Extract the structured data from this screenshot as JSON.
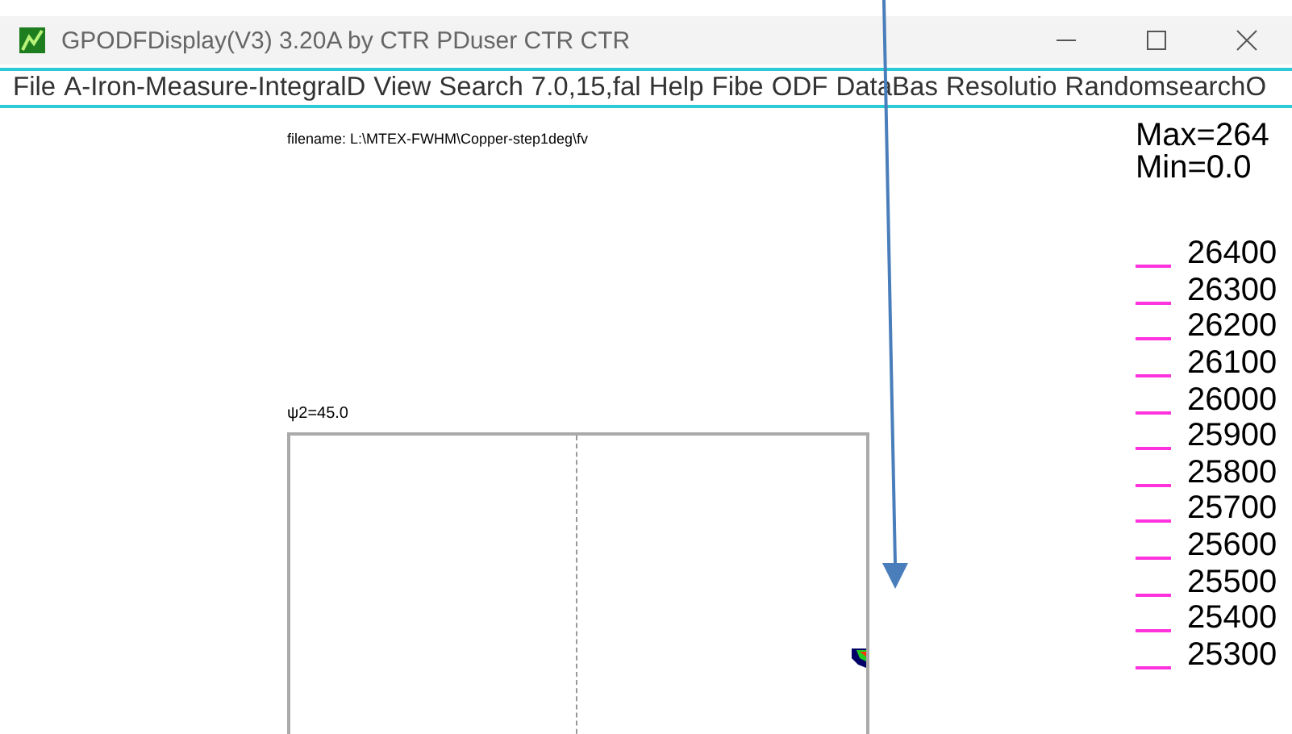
{
  "window": {
    "title": "GPODFDisplay(V3) 3.20A by CTR PDuser CTR CTR"
  },
  "menu": [
    "File",
    "A-Iron-Measure-IntegralD",
    "View",
    "Search",
    "7.0,15,fal",
    "Help",
    "Fibe",
    "ODF",
    "DataBas",
    "Resolutio",
    "RandomsearchO"
  ],
  "filename": "filename: L:\\MTEX-FWHM\\Copper-step1deg\\fv",
  "plot": {
    "label": "ψ2=45.0"
  },
  "legend": {
    "max": "Max=264",
    "min": "Min=0.0",
    "levels": [
      "26400",
      "26300",
      "26200",
      "26100",
      "26000",
      "25900",
      "25800",
      "25700",
      "25600",
      "25500",
      "25400",
      "25300"
    ]
  }
}
